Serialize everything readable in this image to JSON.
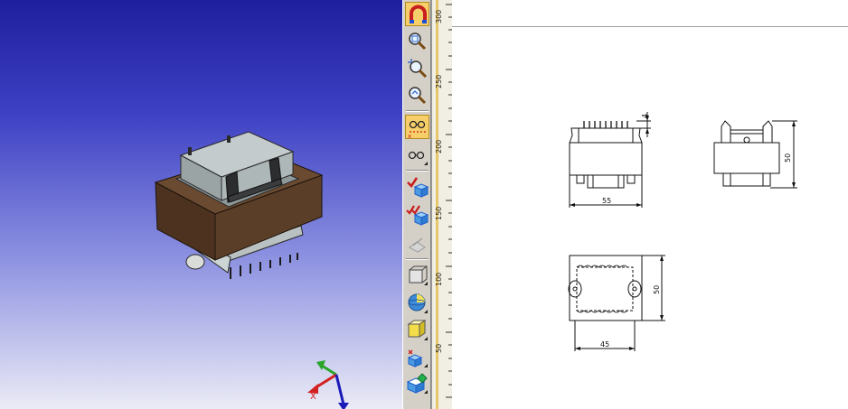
{
  "viewport": {
    "axes": {
      "x_label": "X"
    }
  },
  "toolbar": {
    "buttons": [
      {
        "icon": "magnet-snap-icon",
        "active": true
      },
      {
        "icon": "zoom-window-icon",
        "active": false
      },
      {
        "icon": "zoom-fit-icon",
        "active": false
      },
      {
        "icon": "zoom-previous-icon",
        "active": false
      },
      {
        "icon": "hidden-lines-dashed-icon",
        "active": true
      },
      {
        "icon": "hidden-lines-visible-icon",
        "active": false
      },
      {
        "icon": "check-part-icon",
        "active": false
      },
      {
        "icon": "check-parts-multiple-icon",
        "active": false
      },
      {
        "icon": "measure-disabled-icon",
        "active": false
      },
      {
        "icon": "wireframe-box-icon",
        "active": false
      },
      {
        "icon": "render-sphere-icon",
        "active": false
      },
      {
        "icon": "shaded-cube-icon",
        "active": false
      },
      {
        "icon": "section-cube-icon",
        "active": false
      },
      {
        "icon": "color-cube-icon",
        "active": false
      }
    ]
  },
  "ruler": {
    "labels": [
      "300",
      "250",
      "200",
      "150",
      "100",
      "50"
    ]
  },
  "drawing": {
    "views": {
      "front": {
        "dim_width": "55",
        "dim_pins": "4"
      },
      "side": {
        "dim_height": "50"
      },
      "top": {
        "dim_width": "45",
        "dim_height": "50"
      }
    }
  },
  "colors": {
    "viewport_top": "#1e1f9e",
    "viewport_bottom": "#ebebf6",
    "core_brown": "#5a3f2a",
    "bobbin_gray": "#a6afb0",
    "toolbar_bg": "#d4d0c8",
    "active_button": "#f6cf6a"
  }
}
